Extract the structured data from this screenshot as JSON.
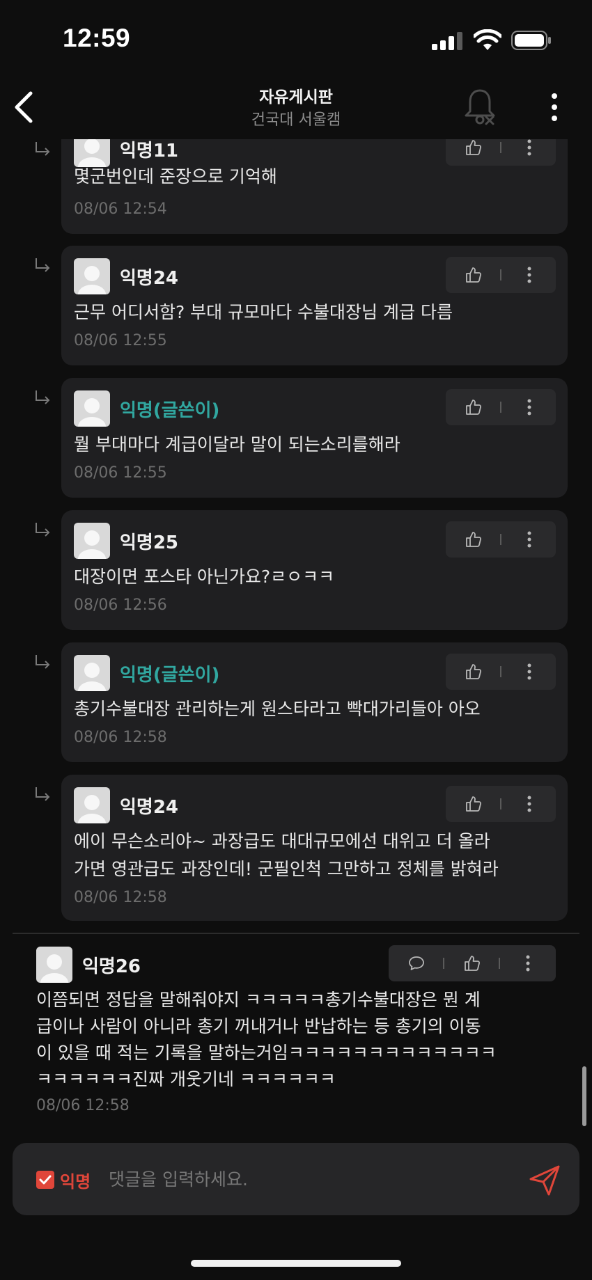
{
  "status": {
    "time": "12:59",
    "icons": [
      "cellular-signal-icon",
      "wifi-icon",
      "battery-icon"
    ]
  },
  "nav": {
    "title": "자유게시판",
    "subtitle": "건국대 서울캠",
    "icons": [
      "back-chevron-icon",
      "bell-off-icon",
      "more-vertical-icon"
    ]
  },
  "replies": [
    {
      "author": "익명11",
      "is_op": false,
      "lines": [
        "몇군번인데 준장으로 기억해"
      ],
      "timestamp": "08/06 12:54"
    },
    {
      "author": "익명24",
      "is_op": false,
      "lines": [
        "근무 어디서함? 부대 규모마다 수불대장님 계급 다름"
      ],
      "timestamp": "08/06 12:55"
    },
    {
      "author": "익명(글쓴이)",
      "is_op": true,
      "lines": [
        "뭘 부대마다 계급이달라 말이 되는소리를해라"
      ],
      "timestamp": "08/06 12:55"
    },
    {
      "author": "익명25",
      "is_op": false,
      "lines": [
        "대장이면 포스타 아닌가요?ㄹㅇㅋㅋ"
      ],
      "timestamp": "08/06 12:56"
    },
    {
      "author": "익명(글쓴이)",
      "is_op": true,
      "lines": [
        "총기수불대장 관리하는게 원스타라고 빡대가리들아 아오"
      ],
      "timestamp": "08/06 12:58"
    },
    {
      "author": "익명24",
      "is_op": false,
      "lines": [
        "에이 무슨소리야~ 과장급도 대대규모에선 대위고 더 올라",
        "가면 영관급도 과장인데! 군필인척 그만하고 정체를 밝혀라"
      ],
      "timestamp": "08/06 12:58"
    }
  ],
  "comment": {
    "author": "익명26",
    "lines": [
      "이쯤되면 정답을 말해줘야지 ㅋㅋㅋㅋㅋ총기수불대장은 뭔 계",
      "급이나 사람이 아니라 총기 꺼내거나 반납하는 등 총기의 이동",
      "이 있을 때 적는 기록을 말하는거임ㅋㅋㅋㅋㅋㅋㅋㅋㅋㅋㅋㅋㅋ",
      "ㅋㅋㅋㅋㅋㅋ진짜 개웃기네 ㅋㅋㅋㅋㅋㅋ"
    ],
    "timestamp": "08/06 12:58"
  },
  "composer": {
    "anonymous_label": "익명",
    "anonymous_checked": true,
    "placeholder": "댓글을 입력하세요."
  },
  "colors": {
    "background": "#0e0e0e",
    "card": "#1f1f21",
    "op_author": "#31a7a0",
    "accent_red": "#e0463a",
    "timestamp": "#6d6d6d"
  }
}
